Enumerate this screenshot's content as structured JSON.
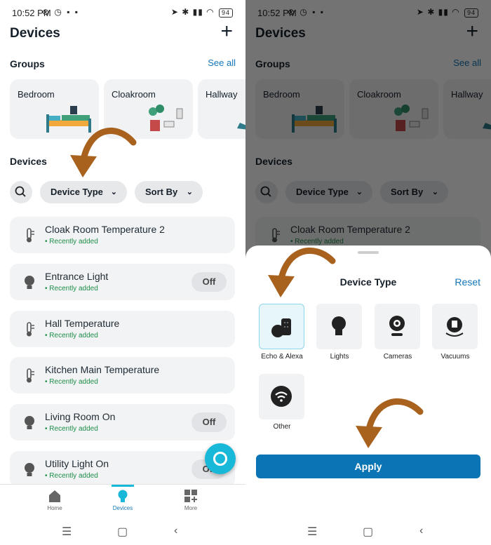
{
  "status_bar": {
    "time": "10:52 PM",
    "battery": "94"
  },
  "header": {
    "title": "Devices",
    "add_label": "+"
  },
  "groups": {
    "heading": "Groups",
    "see_all": "See all",
    "items": [
      {
        "label": "Bedroom"
      },
      {
        "label": "Cloakroom"
      },
      {
        "label": "Hallway"
      }
    ]
  },
  "devices_section": {
    "heading": "Devices",
    "filter_device_type": "Device Type",
    "filter_sort_by": "Sort By",
    "items": [
      {
        "name": "Cloak Room Temperature 2",
        "status": "• Recently added",
        "icon": "thermometer-icon"
      },
      {
        "name": "Entrance Light",
        "status": "• Recently added",
        "icon": "light-bulb-icon",
        "power": "Off"
      },
      {
        "name": "Hall Temperature",
        "status": "• Recently added",
        "icon": "thermometer-icon"
      },
      {
        "name": "Kitchen Main Temperature",
        "status": "• Recently added",
        "icon": "thermometer-icon"
      },
      {
        "name": "Living Room On",
        "status": "• Recently added",
        "icon": "light-bulb-icon",
        "power": "Off"
      },
      {
        "name": "Utility Light On",
        "status": "• Recently added",
        "icon": "light-bulb-icon",
        "power": "Off"
      }
    ]
  },
  "bottom_nav": {
    "items": [
      {
        "label": "Home",
        "icon": "home-icon"
      },
      {
        "label": "Devices",
        "icon": "devices-bulb-icon",
        "active": true
      },
      {
        "label": "More",
        "icon": "grid-plus-icon"
      }
    ]
  },
  "sheet": {
    "title": "Device Type",
    "reset": "Reset",
    "options": [
      {
        "label": "Echo & Alexa",
        "icon": "echo-speaker-icon",
        "selected": true
      },
      {
        "label": "Lights",
        "icon": "light-bulb-icon"
      },
      {
        "label": "Cameras",
        "icon": "camera-icon"
      },
      {
        "label": "Vacuums",
        "icon": "vacuum-icon"
      },
      {
        "label": "Other",
        "icon": "wifi-icon"
      }
    ],
    "apply": "Apply"
  },
  "colors": {
    "accent": "#1477b8",
    "apply_button": "#0b74b4",
    "status_green": "#1e8e4a",
    "alexa_fab": "#18b8d8",
    "annotation_arrow": "#a8621e"
  }
}
